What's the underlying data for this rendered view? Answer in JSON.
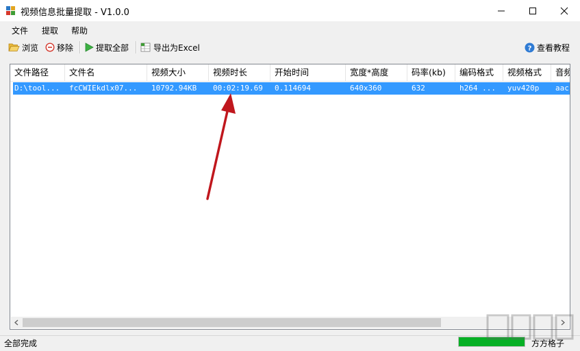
{
  "window": {
    "title": "视频信息批量提取 - V1.0.0",
    "icon": "app-grid-icon",
    "controls": [
      "minimize-icon",
      "maximize-icon",
      "close-icon"
    ]
  },
  "menu": [
    "文件",
    "提取",
    "帮助"
  ],
  "toolbar": {
    "browse": "浏览",
    "remove": "移除",
    "extract_all": "提取全部",
    "export_excel": "导出为Excel",
    "tutorial": "查看教程"
  },
  "table": {
    "columns": [
      "文件路径",
      "文件名",
      "视频大小",
      "视频时长",
      "开始时间",
      "宽度*高度",
      "码率(kb)",
      "编码格式",
      "视频格式",
      "音频"
    ],
    "rows": [
      [
        "D:\\tool...",
        "fcCWIEkdlx07...",
        "10792.94KB",
        "00:02:19.69",
        "0.114694",
        "640x360",
        "632",
        "h264 ...",
        "yuv420p",
        "aac"
      ]
    ],
    "selected_row": 0
  },
  "status": {
    "text": "全部完成",
    "progress": 1.0,
    "right_text": "方方格子"
  },
  "colors": {
    "selection": "#3399ff",
    "progress": "#06b025",
    "annotation_arrow": "#c0171d"
  }
}
